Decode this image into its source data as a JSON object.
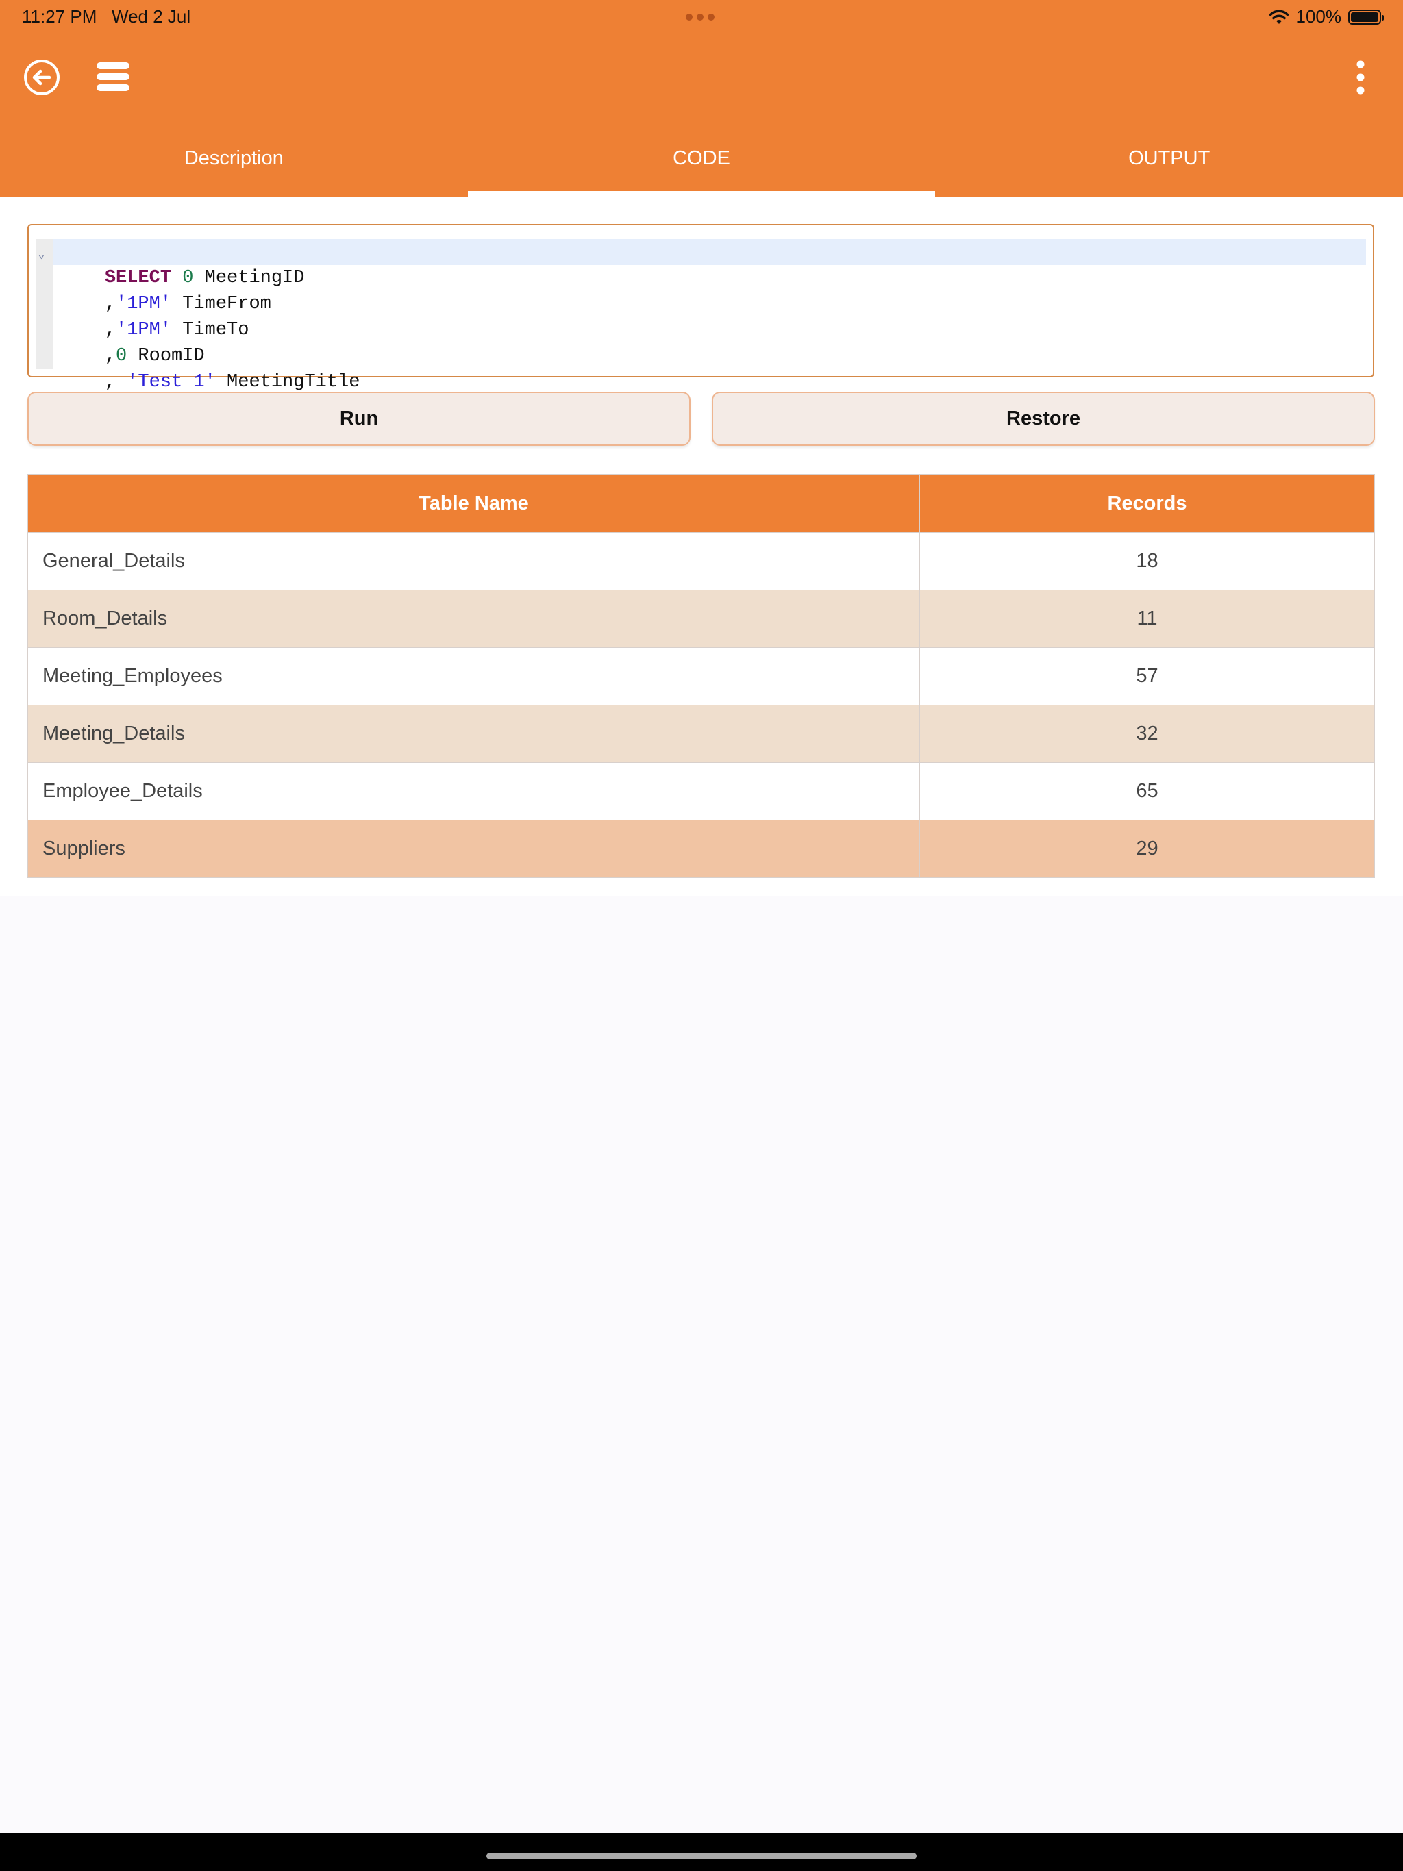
{
  "status_bar": {
    "time": "11:27 PM",
    "date": "Wed 2 Jul",
    "battery": "100%"
  },
  "toolbar": {
    "back_icon": "back-arrow-circle-icon",
    "menu_icon": "hamburger-menu-icon",
    "more_icon": "vertical-ellipsis-icon"
  },
  "tabs": [
    {
      "label": "Description",
      "active": false
    },
    {
      "label": "CODE",
      "active": true
    },
    {
      "label": "OUTPUT",
      "active": false
    }
  ],
  "editor": {
    "lines": [
      [
        "SELECT",
        " ",
        "0",
        " MeetingID"
      ],
      [
        ",",
        "'1PM'",
        " TimeFrom"
      ],
      [
        ",",
        "'1PM'",
        " TimeTo"
      ],
      [
        ",",
        "0",
        " RoomID"
      ],
      [
        ", ",
        "'Test 1'",
        " MeetingTitle"
      ]
    ]
  },
  "actions": {
    "run_label": "Run",
    "restore_label": "Restore"
  },
  "table": {
    "headers": [
      "Table Name",
      "Records"
    ],
    "rows": [
      {
        "name": "General_Details",
        "records": "18"
      },
      {
        "name": "Room_Details",
        "records": "11"
      },
      {
        "name": "Meeting_Employees",
        "records": "57"
      },
      {
        "name": "Meeting_Details",
        "records": "32"
      },
      {
        "name": "Employee_Details",
        "records": "65"
      },
      {
        "name": "Suppliers",
        "records": "29"
      }
    ],
    "selected_row": 5
  },
  "colors": {
    "accent": "#ee8034",
    "row_alt": "#efdecd",
    "row_selected": "#f1c4a3"
  }
}
